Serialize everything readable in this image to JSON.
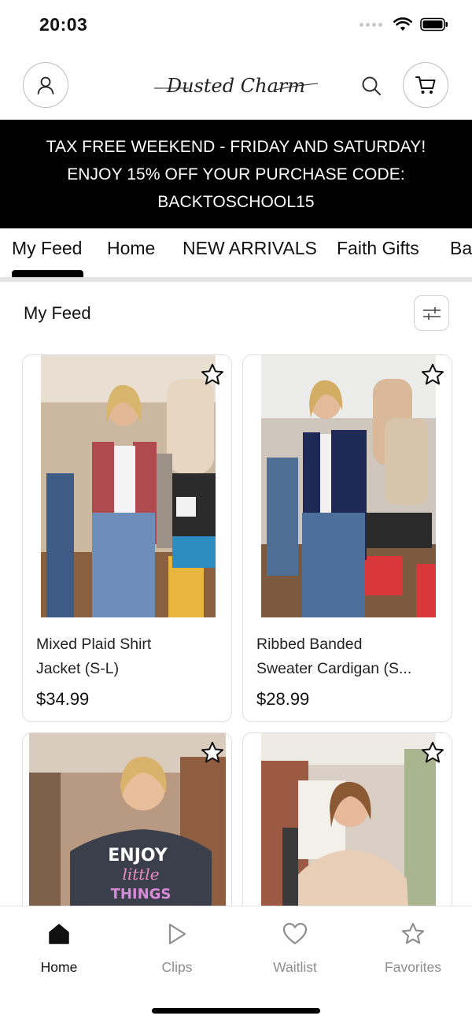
{
  "status_bar": {
    "time": "20:03"
  },
  "header": {
    "logo_text": "Dusted Charm"
  },
  "banner": {
    "lines": [
      "TAX FREE WEEKEND - FRIDAY AND SATURDAY!",
      "ENJOY 15% OFF YOUR PURCHASE CODE:",
      "BACKTOSCHOOL15"
    ]
  },
  "tabs": [
    {
      "label": "My Feed",
      "active": true
    },
    {
      "label": "Home"
    },
    {
      "label": "NEW ARRIVALS"
    },
    {
      "label": "Faith Gifts"
    },
    {
      "label": "Ba"
    }
  ],
  "feed": {
    "title": "My Feed"
  },
  "products": [
    {
      "name_line1": "Mixed Plaid Shirt",
      "name_line2": "Jacket (S-L)",
      "price": "$34.99"
    },
    {
      "name_line1": "Ribbed Banded",
      "name_line2": "Sweater Cardigan (S...",
      "price": "$28.99"
    },
    {
      "name_line1": "",
      "name_line2": "",
      "price": ""
    },
    {
      "name_line1": "",
      "name_line2": "",
      "price": ""
    }
  ],
  "product3_shirt_text": [
    "ENJOY",
    "little",
    "THINGS"
  ],
  "bottom_nav": {
    "home": "Home",
    "clips": "Clips",
    "waitlist": "Waitlist",
    "favorites": "Favorites"
  },
  "icons": {
    "account": "user-icon",
    "search": "search-icon",
    "cart": "cart-icon",
    "filter": "sliders-icon",
    "favorite": "star-outline-icon",
    "home": "home-icon",
    "clips": "play-icon",
    "waitlist": "heart-icon",
    "favorites": "star-icon"
  },
  "colors": {
    "banner_bg": "#000000",
    "active": "#111111",
    "inactive": "#8e8e8e"
  }
}
